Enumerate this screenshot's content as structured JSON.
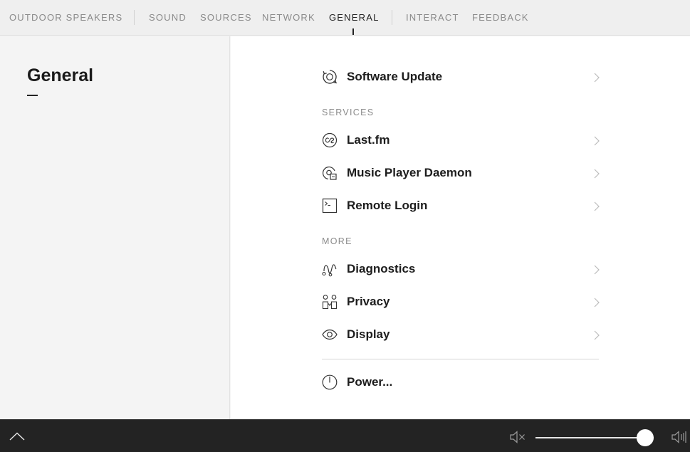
{
  "nav": {
    "device": "OUTDOOR SPEAKERS",
    "tabs": [
      {
        "label": "SOUND"
      },
      {
        "label": "SOURCES"
      },
      {
        "label": "NETWORK"
      },
      {
        "label": "GENERAL"
      },
      {
        "label": "INTERACT"
      },
      {
        "label": "FEEDBACK"
      }
    ],
    "active_tab": "GENERAL"
  },
  "page": {
    "title": "General"
  },
  "menu": {
    "software_update": "Software Update",
    "services_header": "SERVICES",
    "services": [
      {
        "label": "Last.fm",
        "icon": "lastfm-icon"
      },
      {
        "label": "Music Player Daemon",
        "icon": "mpd-icon"
      },
      {
        "label": "Remote Login",
        "icon": "terminal-icon"
      }
    ],
    "more_header": "MORE",
    "more": [
      {
        "label": "Diagnostics",
        "icon": "diagnostics-icon"
      },
      {
        "label": "Privacy",
        "icon": "privacy-icon"
      },
      {
        "label": "Display",
        "icon": "eye-icon"
      }
    ],
    "power": "Power..."
  },
  "player": {
    "volume": 0.93,
    "icons": [
      "chevron-up-icon",
      "mute-icon",
      "volume-max-icon"
    ]
  },
  "colors": {
    "bottom_bar": "#232323",
    "accent": "#222222"
  }
}
